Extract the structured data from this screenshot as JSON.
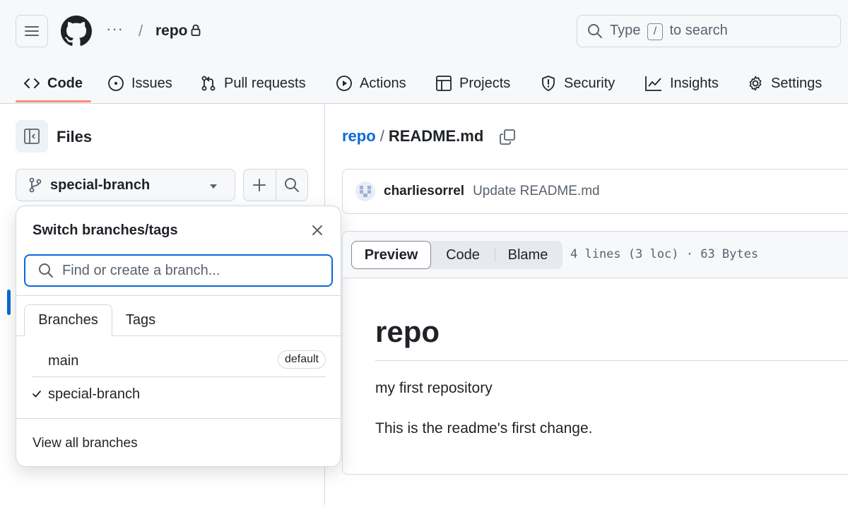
{
  "header": {
    "menu_icon": "hamburger-icon",
    "logo_icon": "github-mark-icon",
    "breadcrumb_more": "···",
    "breadcrumb_sep": "/",
    "repo_name": "repo",
    "search": {
      "prefix": "Type",
      "key": "/",
      "suffix": "to search"
    }
  },
  "nav": {
    "tabs": [
      {
        "label": "Code",
        "icon": "code-icon",
        "active": true
      },
      {
        "label": "Issues",
        "icon": "issue-opened-icon"
      },
      {
        "label": "Pull requests",
        "icon": "git-pull-request-icon"
      },
      {
        "label": "Actions",
        "icon": "play-icon"
      },
      {
        "label": "Projects",
        "icon": "table-icon"
      },
      {
        "label": "Security",
        "icon": "shield-icon"
      },
      {
        "label": "Insights",
        "icon": "graph-icon"
      },
      {
        "label": "Settings",
        "icon": "gear-icon"
      }
    ]
  },
  "sidebar": {
    "title": "Files",
    "branch": "special-branch"
  },
  "branch_dropdown": {
    "title": "Switch branches/tags",
    "search_placeholder": "Find or create a branch...",
    "tabs": [
      "Branches",
      "Tags"
    ],
    "items": [
      {
        "name": "main",
        "badge": "default",
        "selected": false
      },
      {
        "name": "special-branch",
        "badge": "",
        "selected": true
      }
    ],
    "footer": "View all branches"
  },
  "main": {
    "breadcrumb": {
      "repo": "repo",
      "sep": "/",
      "file": "README.md"
    },
    "commit": {
      "author": "charliesorrel",
      "message": "Update README.md"
    },
    "view_tabs": [
      "Preview",
      "Code",
      "Blame"
    ],
    "file_meta": "4 lines (3 loc) · 63 Bytes",
    "readme": {
      "heading": "repo",
      "paragraphs": [
        "my first repository",
        "This is the readme's first change."
      ]
    }
  },
  "colors": {
    "accent_link": "#0969da",
    "tab_underline": "#fd8c73",
    "border": "#d1d9e0"
  }
}
